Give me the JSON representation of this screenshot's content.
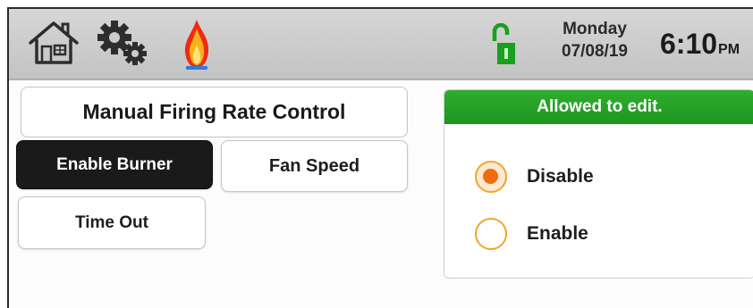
{
  "header": {
    "icons": [
      "home-icon",
      "gear-icon",
      "flame-icon",
      "unlocked-padlock-icon"
    ],
    "day": "Monday",
    "date": "07/08/19",
    "time": "6:10",
    "ampm": "PM"
  },
  "main": {
    "title": "Manual Firing Rate Control",
    "buttons": {
      "enable_burner": "Enable Burner",
      "fan_speed": "Fan Speed",
      "time_out": "Time Out"
    }
  },
  "panel": {
    "header": "Allowed to edit.",
    "options": [
      {
        "label": "Disable",
        "selected": true
      },
      {
        "label": "Enable",
        "selected": false
      }
    ]
  },
  "colors": {
    "accent_green": "#1e9620",
    "radio_selected": "#ef6d12",
    "radio_ring": "#f0a62a",
    "dark_button": "#1a1a1a"
  }
}
